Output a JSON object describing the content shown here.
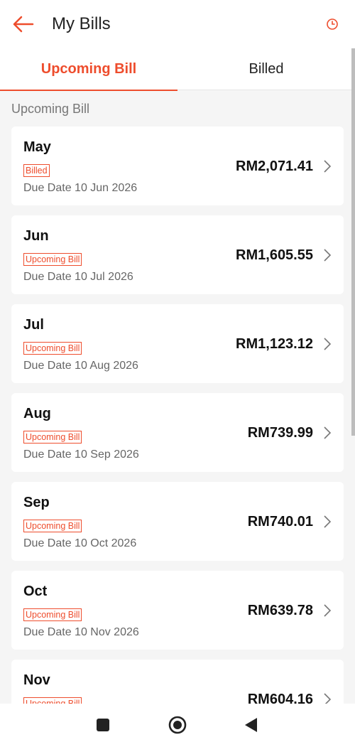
{
  "header": {
    "title": "My Bills",
    "back_icon": "arrow-left-icon",
    "history_icon": "clock-icon"
  },
  "tabs": [
    {
      "label": "Upcoming Bill",
      "active": true
    },
    {
      "label": "Billed",
      "active": false
    }
  ],
  "section_title": "Upcoming Bill",
  "bills": [
    {
      "month": "May",
      "badge": "Billed",
      "due": "Due Date 10 Jun 2026",
      "amount": "RM2,071.41"
    },
    {
      "month": "Jun",
      "badge": "Upcoming Bill",
      "due": "Due Date 10 Jul 2026",
      "amount": "RM1,605.55"
    },
    {
      "month": "Jul",
      "badge": "Upcoming Bill",
      "due": "Due Date 10 Aug 2026",
      "amount": "RM1,123.12"
    },
    {
      "month": "Aug",
      "badge": "Upcoming Bill",
      "due": "Due Date 10 Sep 2026",
      "amount": "RM739.99"
    },
    {
      "month": "Sep",
      "badge": "Upcoming Bill",
      "due": "Due Date 10 Oct 2026",
      "amount": "RM740.01"
    },
    {
      "month": "Oct",
      "badge": "Upcoming Bill",
      "due": "Due Date 10 Nov 2026",
      "amount": "RM639.78"
    },
    {
      "month": "Nov",
      "badge": "Upcoming Bill",
      "due": "",
      "amount": "RM604.16"
    }
  ],
  "colors": {
    "accent": "#ee4d2d",
    "background": "#f5f5f5"
  },
  "navbar": {
    "icons": [
      "square-icon",
      "circle-icon",
      "triangle-back-icon"
    ]
  }
}
